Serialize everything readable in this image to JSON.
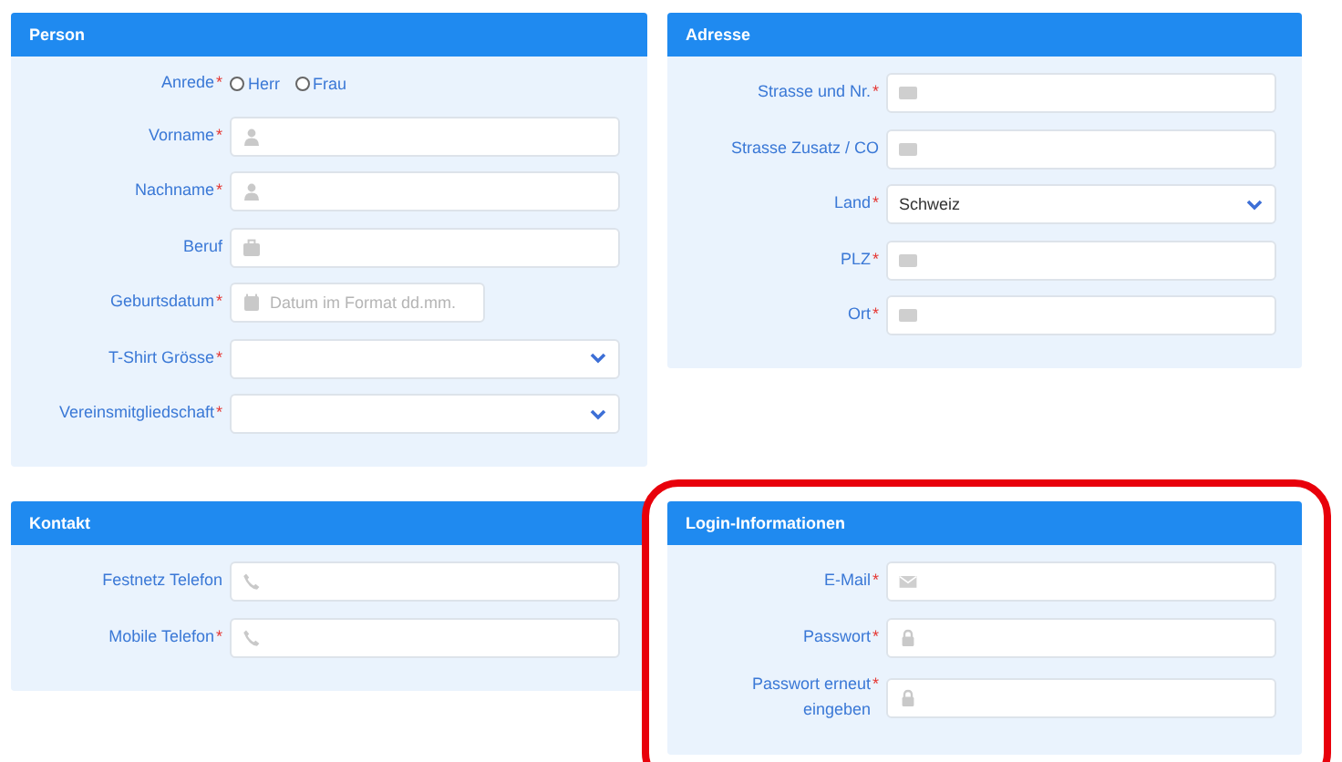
{
  "panels": [
    {
      "title": "Person",
      "fields": [
        {
          "label": "Anrede",
          "mark": "*",
          "kind": "radio",
          "options": [
            {
              "label": "Herr",
              "selected": false
            },
            {
              "label": "Frau",
              "selected": false
            }
          ]
        },
        {
          "label": "Vorname",
          "mark": "*",
          "kind": "name"
        },
        {
          "label": "Nachname",
          "mark": "*",
          "kind": "name"
        },
        {
          "label": "Beruf",
          "kind": "job"
        },
        {
          "label": "Geburtsdatum",
          "mark": "*",
          "kind": "date",
          "placeholder": "Datum im Format dd.mm."
        },
        {
          "label": "T-Shirt Grösse",
          "mark": "*",
          "kind": "select"
        },
        {
          "label": "Vereinsmitgliedschaft",
          "mark": "*",
          "kind": "select"
        }
      ]
    },
    {
      "title": "Adresse",
      "fields": [
        {
          "label": "Strasse und Nr.",
          "mark": "*",
          "kind": "address"
        },
        {
          "label": "Strasse Zusatz / CO",
          "kind": "address"
        },
        {
          "label": "Land",
          "mark": "*",
          "kind": "select",
          "value": "Schweiz"
        },
        {
          "label": "PLZ",
          "mark": "*",
          "kind": "address"
        },
        {
          "label": "Ort",
          "mark": "*",
          "kind": "address"
        }
      ]
    },
    {
      "title": "Kontakt",
      "fields": [
        {
          "label": "Festnetz Telefon",
          "kind": "phone"
        },
        {
          "label": "Mobile Telefon",
          "mark": "*",
          "kind": "phone"
        }
      ]
    },
    {
      "title": "Login-Informationen",
      "highlighted": true,
      "fields": [
        {
          "label": "E-Mail",
          "mark": "*",
          "kind": "email"
        },
        {
          "label": "Passwort",
          "mark": "*",
          "kind": "password"
        },
        {
          "label": "Passwort erneut eingeben",
          "mark": "*",
          "kind": "password"
        }
      ]
    }
  ]
}
